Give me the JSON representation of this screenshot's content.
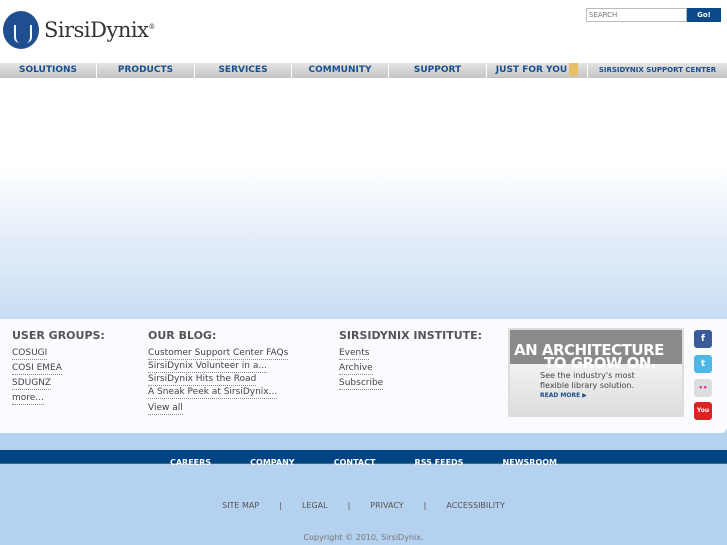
{
  "header": {
    "brand": "SirsiDynix",
    "trademark": "®",
    "search_placeholder": "SEARCH",
    "search_button": "Go!"
  },
  "nav": [
    "SOLUTIONS",
    "PRODUCTS",
    "SERVICES",
    "COMMUNITY",
    "SUPPORT",
    "JUST FOR YOU",
    "SIRSIDYNIX SUPPORT CENTER"
  ],
  "user_groups": {
    "title": "USER GROUPS:",
    "items": [
      "COSUGI",
      "COSI EMEA",
      "SDUGNZ",
      "more..."
    ]
  },
  "blog": {
    "title": "OUR BLOG:",
    "items": [
      "Customer Support Center FAQs",
      "SirsiDynix Volunteer in a...",
      "SirsiDynix Hits the Road",
      "A Sneak Peek at SirsiDynix..."
    ],
    "view_all": "View all"
  },
  "institute": {
    "title": "SIRSIDYNIX INSTITUTE:",
    "items": [
      "Events",
      "Archive",
      "Subscribe"
    ]
  },
  "ad": {
    "headline1": "AN ARCHITECTURE",
    "headline2": "TO GROW ON.",
    "body1": "See the industry's most",
    "body2": "flexible library solution.",
    "cta": "READ MORE ▶"
  },
  "social": {
    "facebook": "f",
    "twitter": "t",
    "flickr": "••",
    "youtube": "You"
  },
  "footer_nav": [
    "CAREERS",
    "COMPANY",
    "CONTACT",
    "RSS FEEDS",
    "NEWSROOM"
  ],
  "footer_links": [
    "SITE MAP",
    "LEGAL",
    "PRIVACY",
    "ACCESSIBILITY"
  ],
  "separator": "|",
  "copyright": "Copyright © 2010, SirsiDynix."
}
